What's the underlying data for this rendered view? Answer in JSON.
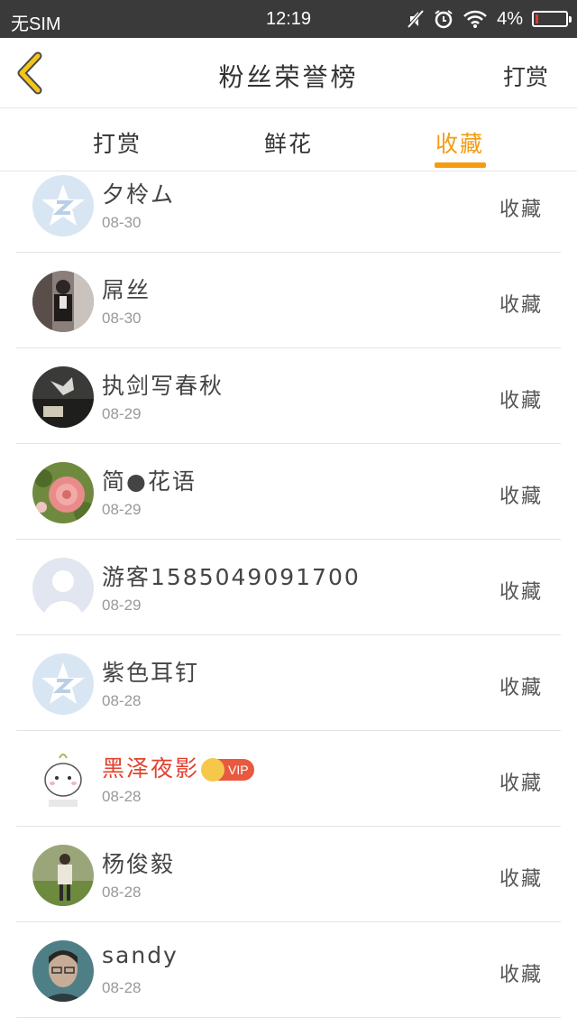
{
  "status_bar": {
    "carrier": "无SIM",
    "time": "12:19",
    "battery": "4%",
    "icons": [
      "mute-icon",
      "alarm-icon",
      "wifi-icon",
      "battery-icon"
    ]
  },
  "header": {
    "title": "粉丝荣誉榜",
    "action_label": "打赏",
    "back_icon": "chevron-left-icon"
  },
  "tabs": [
    {
      "label": "打赏",
      "active": false
    },
    {
      "label": "鲜花",
      "active": false
    },
    {
      "label": "收藏",
      "active": true
    }
  ],
  "colors": {
    "accent": "#f39c12",
    "status_bar": "#3a3a3a",
    "vip_name": "#e2422f",
    "vip_badge": "#e8593f"
  },
  "fans": [
    {
      "name": "夕柃ム",
      "date": "08-30",
      "action": "收藏",
      "avatar": "qzone-default-avatar"
    },
    {
      "name": "屌丝",
      "date": "08-30",
      "action": "收藏",
      "avatar": "photo-avatar"
    },
    {
      "name": "执剑写春秋",
      "date": "08-29",
      "action": "收藏",
      "avatar": "photo-avatar"
    },
    {
      "name": "简●花语",
      "date": "08-29",
      "action": "收藏",
      "avatar": "flower-avatar"
    },
    {
      "name": "游客1585049091700",
      "date": "08-29",
      "action": "收藏",
      "avatar": "guest-default-avatar"
    },
    {
      "name": "紫色耳钉",
      "date": "08-28",
      "action": "收藏",
      "avatar": "qzone-default-avatar"
    },
    {
      "name": "黑泽夜影",
      "date": "08-28",
      "action": "收藏",
      "avatar": "cartoon-avatar",
      "vip": true,
      "vip_label": "VIP"
    },
    {
      "name": "杨俊毅",
      "date": "08-28",
      "action": "收藏",
      "avatar": "photo-avatar"
    },
    {
      "name": "sandy",
      "date": "08-28",
      "action": "收藏",
      "avatar": "photo-avatar"
    }
  ]
}
